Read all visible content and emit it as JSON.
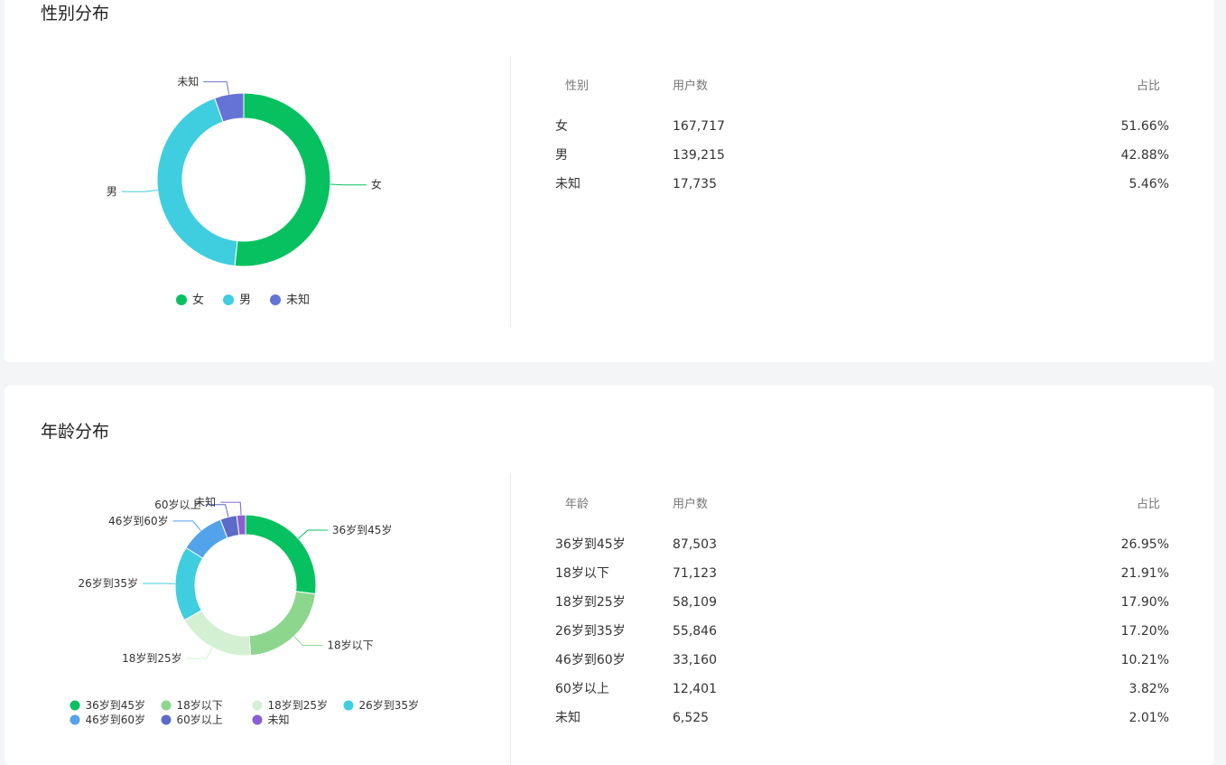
{
  "gender": {
    "title": "性别分布",
    "table": {
      "headers": [
        "性别",
        "用户数",
        "占比"
      ],
      "rows": [
        {
          "label": "女",
          "count": "167,717",
          "pct": "51.66%"
        },
        {
          "label": "男",
          "count": "139,215",
          "pct": "42.88%"
        },
        {
          "label": "未知",
          "count": "17,735",
          "pct": "5.46%"
        }
      ]
    },
    "chart_data": {
      "type": "pie",
      "donut": true,
      "categories": [
        "女",
        "男",
        "未知"
      ],
      "values": [
        167717,
        139215,
        17735
      ],
      "percentages": [
        51.66,
        42.88,
        5.46
      ],
      "colors": [
        "#07c160",
        "#3fcde0",
        "#6573d6"
      ],
      "legend": [
        "女",
        "男",
        "未知"
      ],
      "legend_position": "bottom"
    }
  },
  "age": {
    "title": "年龄分布",
    "table": {
      "headers": [
        "年龄",
        "用户数",
        "占比"
      ],
      "rows": [
        {
          "label": "36岁到45岁",
          "count": "87,503",
          "pct": "26.95%"
        },
        {
          "label": "18岁以下",
          "count": "71,123",
          "pct": "21.91%"
        },
        {
          "label": "18岁到25岁",
          "count": "58,109",
          "pct": "17.90%"
        },
        {
          "label": "26岁到35岁",
          "count": "55,846",
          "pct": "17.20%"
        },
        {
          "label": "46岁到60岁",
          "count": "33,160",
          "pct": "10.21%"
        },
        {
          "label": "60岁以上",
          "count": "12,401",
          "pct": "3.82%"
        },
        {
          "label": "未知",
          "count": "6,525",
          "pct": "2.01%"
        }
      ]
    },
    "chart_data": {
      "type": "pie",
      "donut": true,
      "categories": [
        "36岁到45岁",
        "18岁以下",
        "18岁到25岁",
        "26岁到35岁",
        "46岁到60岁",
        "60岁以上",
        "未知"
      ],
      "values": [
        87503,
        71123,
        58109,
        55846,
        33160,
        12401,
        6525
      ],
      "percentages": [
        26.95,
        21.91,
        17.9,
        17.2,
        10.21,
        3.82,
        2.01
      ],
      "colors": [
        "#07c160",
        "#8dd68d",
        "#d3f0d3",
        "#3fcde0",
        "#52a3ea",
        "#5d6bc8",
        "#8a5fd0"
      ],
      "legend": [
        "36岁到45岁",
        "18岁以下",
        "18岁到25岁",
        "26岁到35岁",
        "46岁到60岁",
        "60岁以上",
        "未知"
      ],
      "legend_position": "bottom"
    }
  }
}
